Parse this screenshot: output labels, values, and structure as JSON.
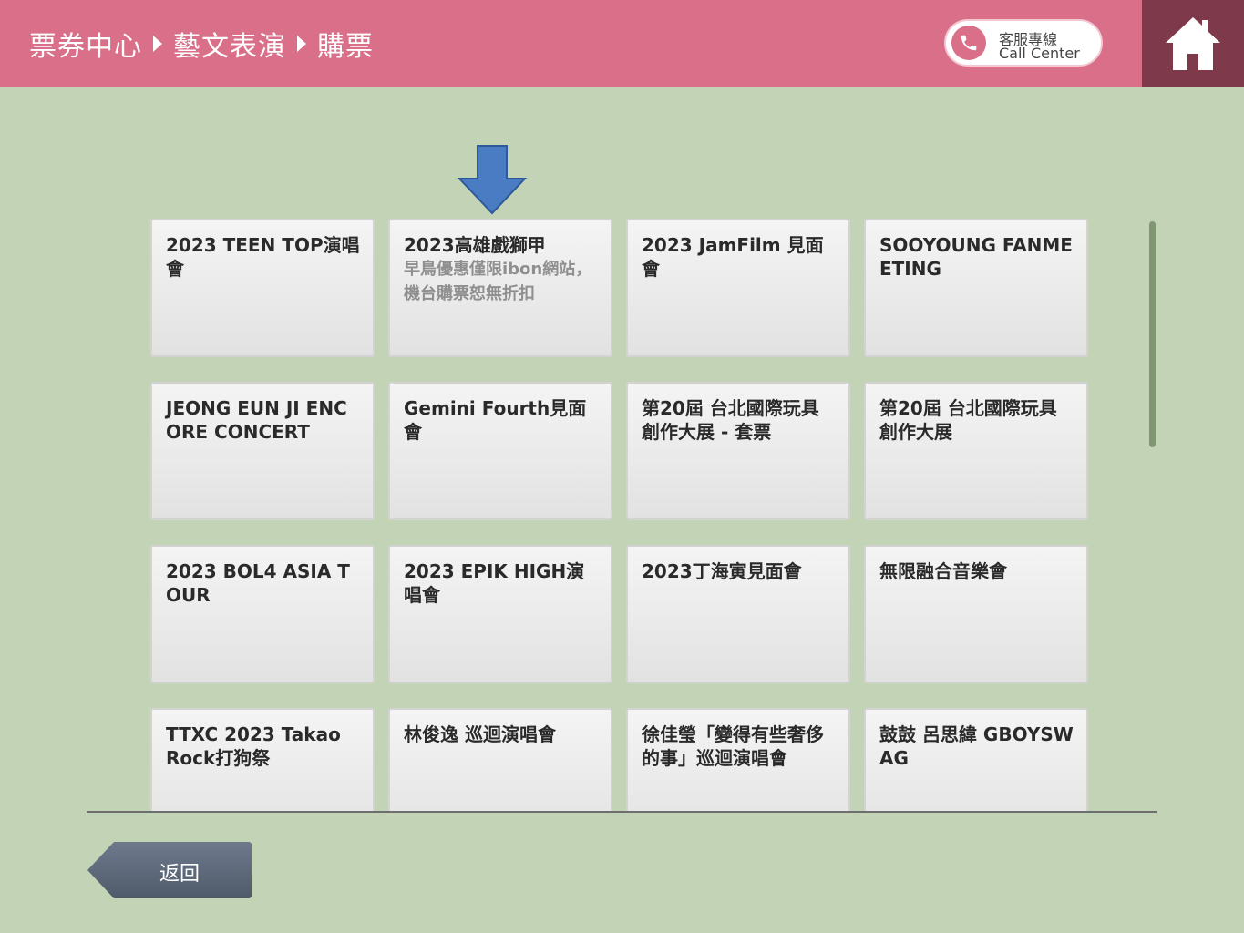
{
  "header": {
    "breadcrumb": [
      "票券中心",
      "藝文表演",
      "購票"
    ],
    "call_center": {
      "line1": "客服專線",
      "line2": "Call Center"
    },
    "home_icon": "home-icon",
    "phone_icon": "phone-icon"
  },
  "colors": {
    "header_bg": "#d96f88",
    "home_bg": "#7e3a4a",
    "page_bg": "#c3d4b6",
    "arrow": "#4a7cc3",
    "back_button": "#5c6879"
  },
  "events": [
    {
      "title": "2023 TEEN TOP演唱會"
    },
    {
      "title": "2023高雄戲獅甲",
      "subtitle": "早鳥優惠僅限ibon網站，機台購票恕無折扣"
    },
    {
      "title": "2023 JamFilm 見面會"
    },
    {
      "title": "SOOYOUNG FANMEETING"
    },
    {
      "title": "JEONG EUN JI ENCORE CONCERT"
    },
    {
      "title": "Gemini Fourth見面會"
    },
    {
      "title": "第20屆 台北國際玩具創作大展 - 套票"
    },
    {
      "title": "第20屆 台北國際玩具創作大展"
    },
    {
      "title": "2023 BOL4 ASIA TOUR"
    },
    {
      "title": "2023 EPIK HIGH演唱會"
    },
    {
      "title": "2023丁海寅見面會"
    },
    {
      "title": "無限融合音樂會"
    },
    {
      "title": "TTXC 2023 Takao Rock打狗祭"
    },
    {
      "title": "林俊逸 巡迴演唱會"
    },
    {
      "title": "徐佳瑩「變得有些奢侈的事」巡迴演唱會"
    },
    {
      "title": "鼓鼓 呂思緯 GBOYSWAG"
    }
  ],
  "back_button": {
    "label": "返回"
  }
}
